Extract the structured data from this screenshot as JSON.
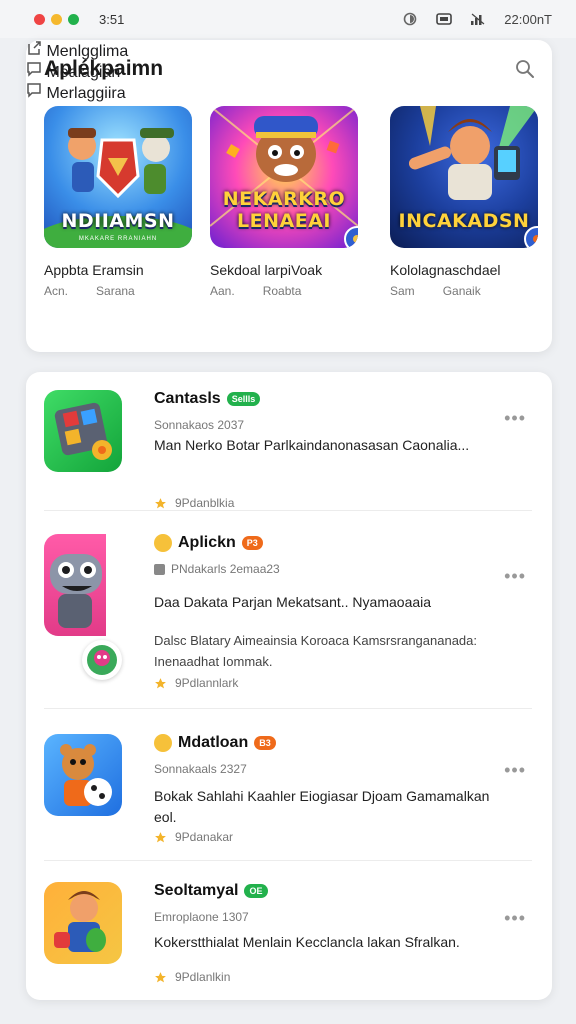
{
  "status": {
    "time": "3:51",
    "right_text": "22:00nT",
    "window_dot_colors": [
      "#ef4444",
      "#f5b82e",
      "#22b14c"
    ]
  },
  "top": {
    "title": "Aplékpaimn",
    "featured": [
      {
        "art_text": "NDIIAMSN",
        "art_sub": "MKAKARE RRANIAHN",
        "name": "Appbta Eramsin",
        "meta_left": "Acn.",
        "meta_right": "Sarana",
        "action": "Menlgglima",
        "colors": [
          "#7ed2ff",
          "#2d6fd8"
        ]
      },
      {
        "art_text": "NEKARKRO LENAEAI",
        "art_sub": "",
        "name": "Sekdoal larpiVoak",
        "meta_left": "Aan.",
        "meta_right": "Roabta",
        "action": "Mealagian",
        "colors": [
          "#ff4bb8",
          "#6a1fd1"
        ]
      },
      {
        "art_text": "INCAKADSN",
        "art_sub": "",
        "name": "Kololagnaschdael",
        "meta_left": "Sam",
        "meta_right": "Ganaik",
        "action": "Merlaggiira",
        "colors": [
          "#1c3f9e",
          "#0b1d55"
        ]
      }
    ]
  },
  "list": [
    {
      "name": "Cantasls",
      "badge": "Sellls",
      "badge_color": "#22b14c",
      "has_emoji": false,
      "sub": "Sonnakaos 2037",
      "desc1": "Man Nerko Botar Parlkaindanonasasan Caonalia...",
      "desc2": "",
      "rating": "9Pdanblkia",
      "icon_colors": [
        "#2fd157",
        "#13a43a"
      ]
    },
    {
      "name": "Aplickn",
      "badge": "P3",
      "badge_color": "#ef6a1a",
      "has_emoji": true,
      "sub": "PNdakarls 2emaa23",
      "desc1": "Daa Dakata Parjan Mekatsant.. Nyamaoaaia",
      "desc2": "Dalsc Blatary Aimeainsia Koroaca Kamsrsrangananada: Inenaadhat Iommak.",
      "rating": "9Pdlannlark",
      "icon_colors": [
        "#ff5ba8",
        "#e23b88"
      ]
    },
    {
      "name": "Mdatloan",
      "badge": "B3",
      "badge_color": "#ef6a1a",
      "has_emoji": true,
      "sub": "Sonnakaals 2327",
      "desc1": "Bokak Sahlahi Kaahler Eiogiasar Djoam Gamamalkan",
      "desc2": "eol.",
      "rating": "9Pdanakar",
      "icon_colors": [
        "#4aa8ff",
        "#1f6fe0"
      ]
    },
    {
      "name": "Seoltamyal",
      "badge": "OE",
      "badge_color": "#22b14c",
      "has_emoji": false,
      "sub": "Emroplaone 1307",
      "desc1": "Kokerstthialat Menlain Kecclancla lakan Sfralkan.",
      "desc2": "",
      "rating": "9Pdlanlkin",
      "icon_colors": [
        "#ff9c2b",
        "#f5c643"
      ]
    }
  ],
  "accent_orange": "#ef6a1a",
  "star_color": "#f3b42b"
}
